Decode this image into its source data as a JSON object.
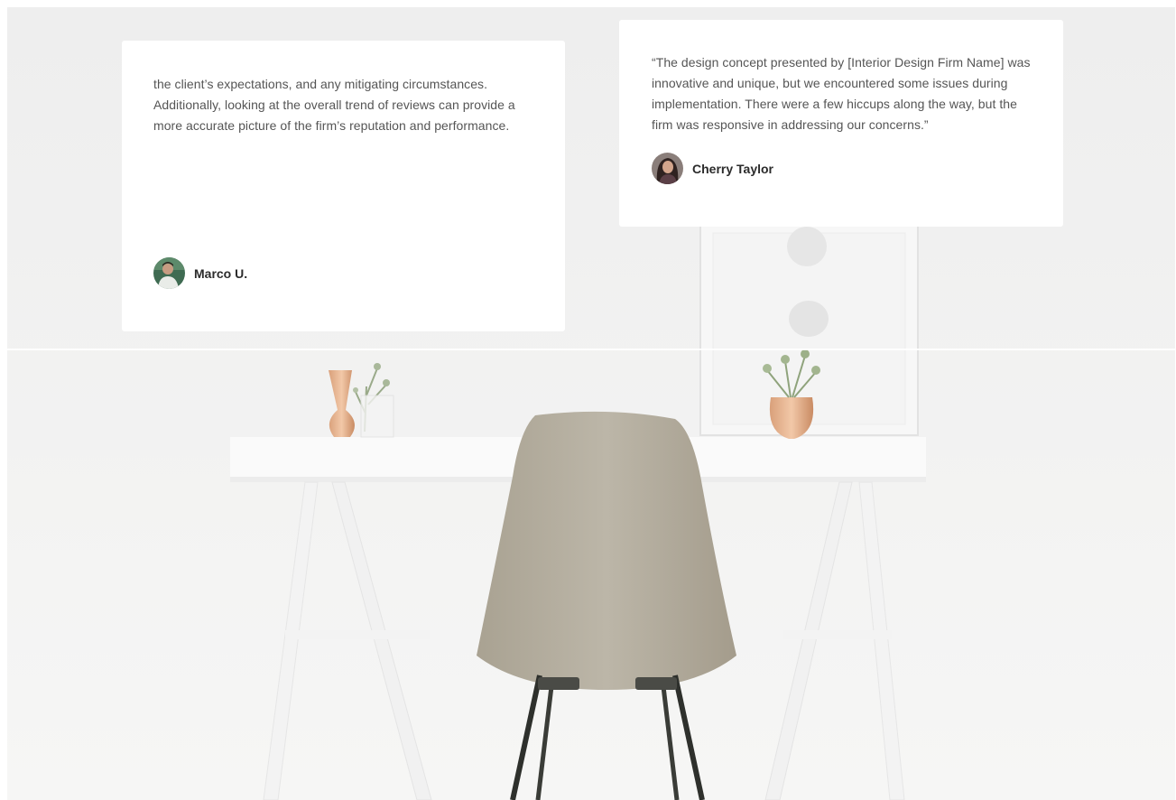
{
  "testimonials": [
    {
      "quote": "the client’s expectations, and any mitigating circumstances. Additionally, looking at the overall trend of reviews can provide a more accurate picture of the firm’s reputation and performance.",
      "author": "Marco U."
    },
    {
      "quote": "“The design concept presented by [Interior Design Firm Name] was innovative and unique, but we encountered some issues during implementation. There were a few hiccups along the way, but the firm was responsive in addressing our concerns.”",
      "author": "Cherry Taylor"
    }
  ],
  "colors": {
    "card_background": "#ffffff",
    "quote_text": "#555555",
    "author_text": "#2b2b2b",
    "chair": "#b8b1a2"
  },
  "icons": {
    "avatar_marco": "avatar-photo-icon",
    "avatar_cherry": "avatar-photo-icon"
  }
}
